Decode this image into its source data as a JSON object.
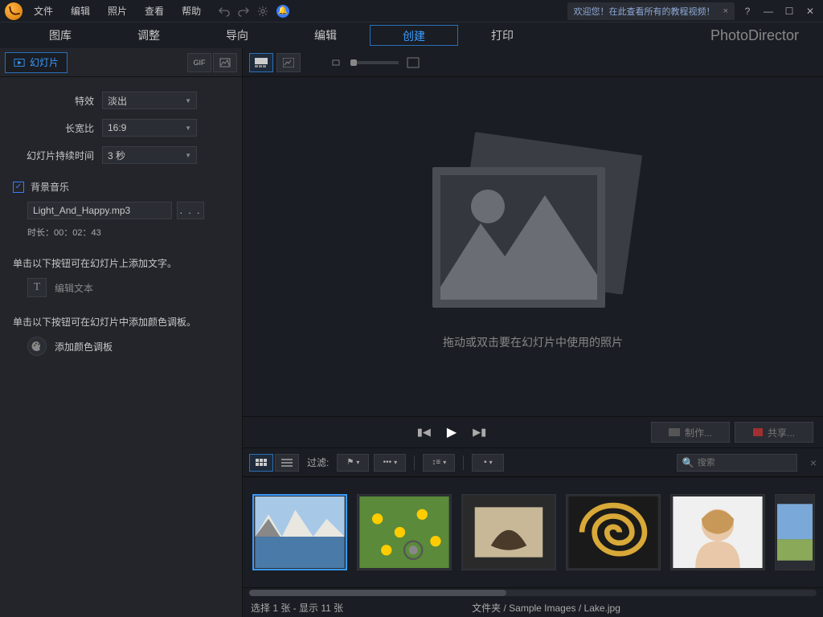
{
  "menu": {
    "file": "文件",
    "edit": "编辑",
    "photo": "照片",
    "view": "查看",
    "help": "帮助"
  },
  "welcome": {
    "text": "欢迎您！在此查看所有的教程视频！",
    "close": "×"
  },
  "winbtns": {
    "help": "?",
    "min": "—",
    "max": "☐",
    "close": "✕"
  },
  "tabs": {
    "library": "图库",
    "adjust": "调整",
    "guide": "导向",
    "edit": "编辑",
    "create": "创建",
    "print": "打印"
  },
  "brand": {
    "name": "PhotoDirector"
  },
  "sidetab": {
    "slideshow": "幻灯片",
    "gif": "GIF"
  },
  "fields": {
    "effect_label": "特效",
    "effect_val": "淡出",
    "aspect_label": "长宽比",
    "aspect_val": "16:9",
    "dur_label": "幻灯片持续时间",
    "dur_val": "3 秒"
  },
  "bgm": {
    "label": "背景音乐",
    "file": "Light_And_Happy.mp3",
    "browse": ". . .",
    "duration": "时长：00：02：43"
  },
  "textHint": "单击以下按钮可在幻灯片上添加文字。",
  "textBtn": "编辑文本",
  "paletteHint": "单击以下按钮可在幻灯片中添加颜色调板。",
  "paletteBtn": "添加颜色调板",
  "dropHint": "拖动或双击要在幻灯片中使用的照片",
  "actions": {
    "make": "制作...",
    "share": "共享..."
  },
  "filterLabel": "过滤:",
  "search": {
    "placeholder": "搜索",
    "icon": "🔍"
  },
  "status": {
    "selection": "选择 1 张 - 显示 11 张",
    "path": "文件夹 / Sample Images / Lake.jpg"
  },
  "thumbs": [
    "Lake",
    "Flowers",
    "Boat",
    "Spiral",
    "Portrait",
    "Landscape"
  ]
}
